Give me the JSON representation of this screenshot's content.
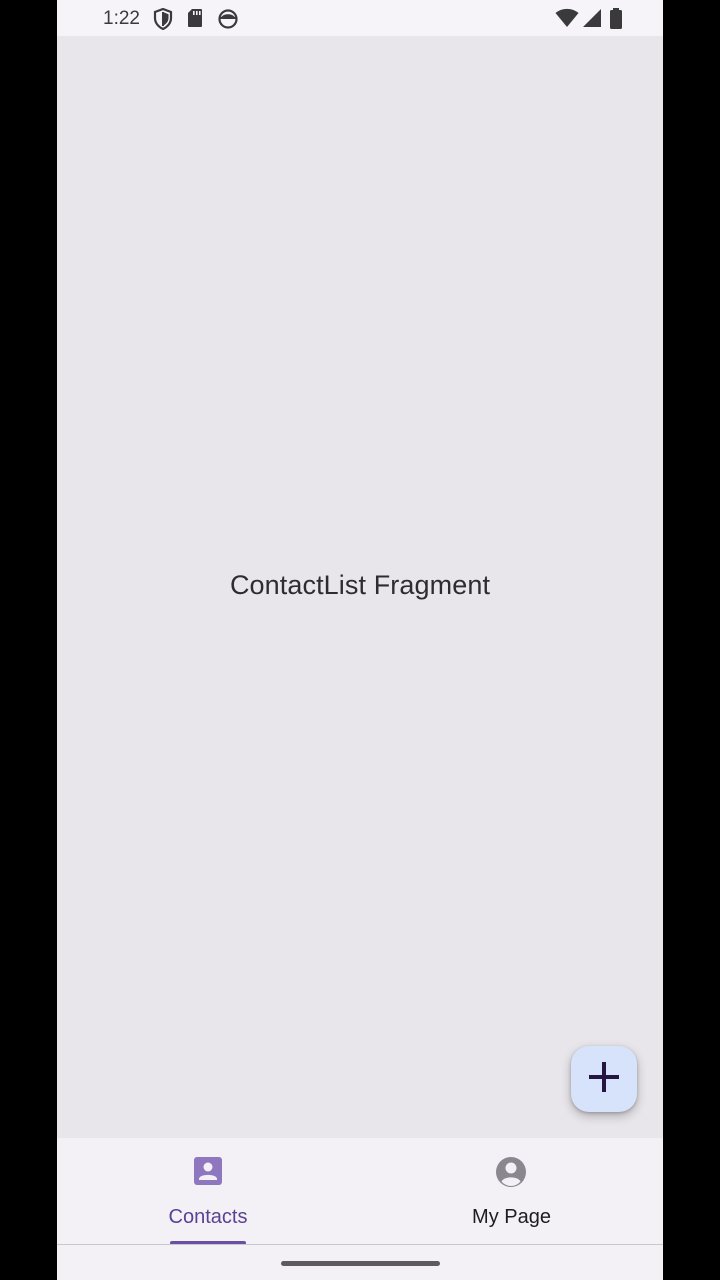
{
  "status_bar": {
    "time": "1:22",
    "left_icons": [
      "shield-icon",
      "sd-card-icon",
      "android-face-icon"
    ],
    "right_icons": [
      "wifi-icon",
      "cell-signal-icon",
      "battery-icon"
    ]
  },
  "content": {
    "label": "ContactList Fragment"
  },
  "fab": {
    "icon": "plus-icon",
    "color": "#d7e3fb"
  },
  "bottom_nav": {
    "items": [
      {
        "label": "Contacts",
        "icon": "contact-card-icon",
        "selected": true
      },
      {
        "label": "My Page",
        "icon": "account-circle-icon",
        "selected": false
      }
    ],
    "accent_color": "#6a4fa5"
  }
}
